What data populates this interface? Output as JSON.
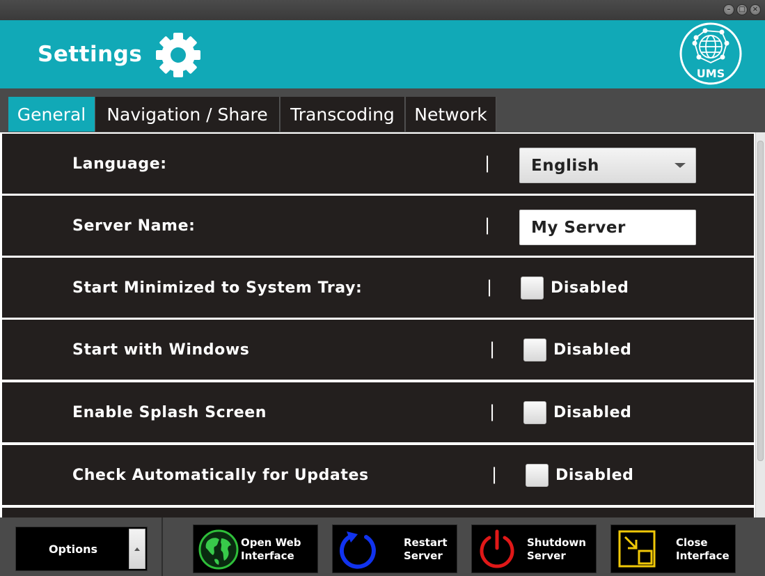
{
  "window": {
    "controls": [
      "minimize",
      "maximize",
      "close"
    ]
  },
  "header": {
    "title": "Settings",
    "logo_text": "UMS",
    "accent": "#11a9b7"
  },
  "tabs": [
    {
      "label": "General",
      "active": true
    },
    {
      "label": "Navigation / Share",
      "active": false
    },
    {
      "label": "Transcoding",
      "active": false
    },
    {
      "label": "Network",
      "active": false
    }
  ],
  "settings": {
    "language": {
      "label": "Language:",
      "value": "English"
    },
    "server_name": {
      "label": "Server Name:",
      "value": "My Server"
    },
    "start_minimized": {
      "label": "Start Minimized to System Tray:",
      "state": "Disabled"
    },
    "start_with_windows": {
      "label": "Start with Windows",
      "state": "Disabled"
    },
    "splash_screen": {
      "label": "Enable Splash Screen",
      "state": "Disabled"
    },
    "check_updates": {
      "label": "Check Automatically for Updates",
      "state": "Disabled"
    },
    "separator": "|"
  },
  "bottom": {
    "options_label": "Options",
    "buttons": {
      "open_web": "Open Web\nInterface",
      "restart": "Restart\nServer",
      "shutdown": "Shutdown\nServer",
      "close": "Close\nInterface"
    }
  }
}
